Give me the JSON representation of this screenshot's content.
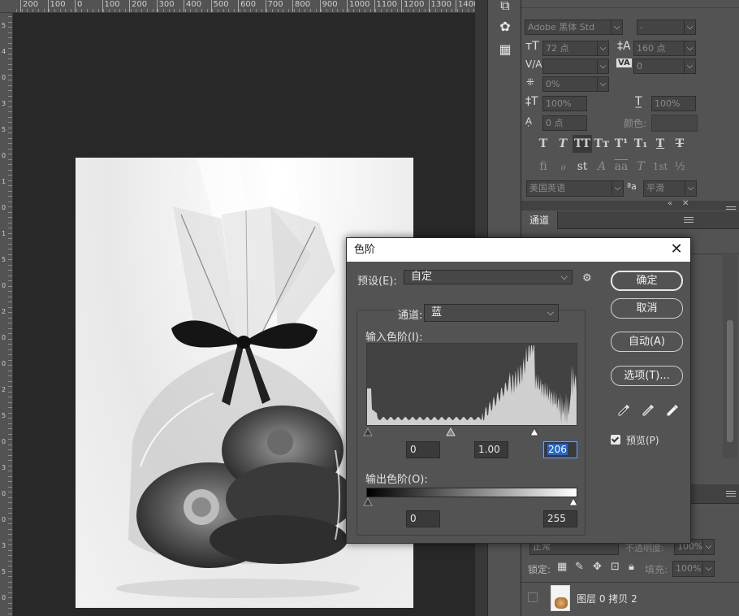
{
  "ruler": {
    "top_labels": [
      "200",
      "100",
      "0",
      "100",
      "200",
      "300",
      "400",
      "500",
      "600",
      "700",
      "800",
      "900",
      "1000",
      "1100",
      "1200",
      "1300",
      "1400"
    ],
    "left_labels": [
      "5",
      "4",
      "0",
      "3",
      "5",
      "0",
      "1",
      "0",
      "1",
      "5",
      "0",
      "2",
      "0",
      "0",
      "2",
      "5",
      "0",
      "3",
      "0",
      "0",
      "3",
      "5",
      "0"
    ]
  },
  "character_panel": {
    "font_family": "Adobe 黑体 Std",
    "font_style": "-",
    "font_size": "72 点",
    "leading": "160 点",
    "kerning": "",
    "tracking": "0",
    "tsume": "0%",
    "vertical_scale": "100%",
    "horizontal_scale": "100%",
    "baseline_shift": "0 点",
    "color_label": "颜色:",
    "style_buttons": [
      "T",
      "T",
      "TT",
      "Tт",
      "T¹",
      "T₁",
      "T",
      "T"
    ],
    "opentype_buttons": [
      "fi",
      "ℴ",
      "st",
      "A",
      "aa",
      "T",
      "1st",
      "½"
    ],
    "language": "美国英语",
    "aa_icon": "ªa",
    "antialias": "平滑"
  },
  "channels_panel": {
    "tab": "通道"
  },
  "layers_panel": {
    "blend_mode": "正常",
    "opacity_label": "不透明度:",
    "opacity": "100%",
    "lock_label": "锁定:",
    "fill_label": "填充:",
    "fill": "100%",
    "layer_name": "图层 0 拷贝 2"
  },
  "levels_dialog": {
    "title": "色阶",
    "close": "✕",
    "preset_label": "预设(E):",
    "preset_value": "自定",
    "channel_label": "通道:",
    "channel_value": "蓝",
    "input_levels_label": "输入色阶(I):",
    "input_black": "0",
    "input_gamma": "1.00",
    "input_white": "206",
    "output_levels_label": "输出色阶(O):",
    "output_black": "0",
    "output_white": "255",
    "buttons": {
      "ok": "确定",
      "cancel": "取消",
      "auto": "自动(A)",
      "options": "选项(T)..."
    },
    "preview_label": "预览(P)",
    "preview_checked": true,
    "gear_icon": "⚙"
  },
  "colors": {
    "panel_bg": "#535353",
    "canvas_bg": "#282828",
    "highlight_blue": "#1f66d6"
  }
}
